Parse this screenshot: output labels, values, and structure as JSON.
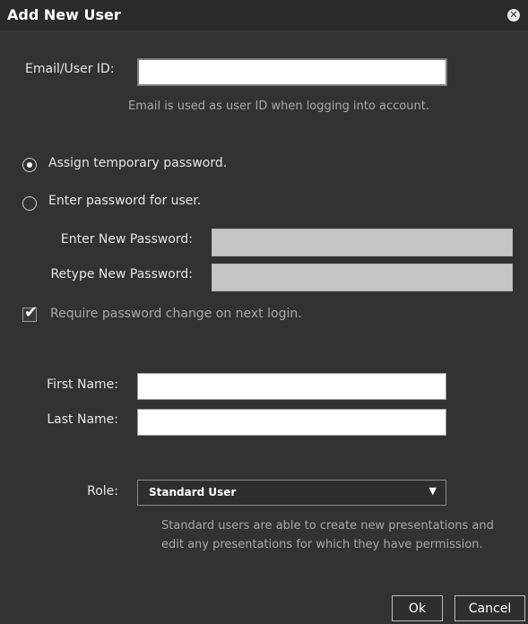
{
  "dialog": {
    "title": "Add New User",
    "close_icon": "close-icon"
  },
  "email": {
    "label": "Email/User ID:",
    "value": "",
    "placeholder": "",
    "hint": "Email is used as user ID when logging into account."
  },
  "password_mode": {
    "options": [
      {
        "label": "Assign temporary password.",
        "selected": true
      },
      {
        "label": "Enter password for user.",
        "selected": false
      }
    ]
  },
  "new_password": {
    "label": "Enter New Password:",
    "value": ""
  },
  "retype_password": {
    "label": "Retype New Password:",
    "value": ""
  },
  "require_change": {
    "label": "Require password change on next login.",
    "checked": true
  },
  "first_name": {
    "label": "First Name:",
    "value": ""
  },
  "last_name": {
    "label": "Last Name:",
    "value": ""
  },
  "role": {
    "label": "Role:",
    "selected": "Standard User",
    "description": "Standard users are able to create new presentations and edit any presentations for which they have permission."
  },
  "buttons": {
    "ok": "Ok",
    "cancel": "Cancel"
  },
  "colors": {
    "background": "#323232",
    "titlebar": "#2a2a2a",
    "text": "#e6e6e6",
    "hint": "#a9a9a9"
  }
}
